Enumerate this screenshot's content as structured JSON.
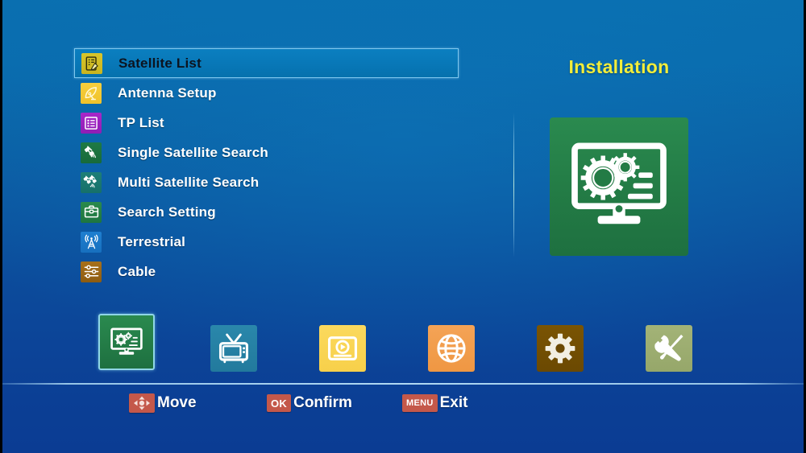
{
  "screen": {
    "title": "Installation",
    "accent_yellow": "#f2ed3a",
    "background_top": "#0a6fb0",
    "background_bottom": "#0b3c93",
    "highlight_border": "#7fc8ef"
  },
  "menu": {
    "selected_index": 0,
    "items": [
      {
        "label": "Satellite List",
        "icon": "satellite-list-icon",
        "tile_color": "#c9b520",
        "selected": true
      },
      {
        "label": "Antenna Setup",
        "icon": "antenna-dish-icon",
        "tile_color": "#f0c22b",
        "selected": false
      },
      {
        "label": "TP List",
        "icon": "transponder-list-icon",
        "tile_color": "#8f1eb4",
        "selected": false
      },
      {
        "label": "Single Satellite Search",
        "icon": "single-satellite-icon",
        "tile_color": "#176a3a",
        "selected": false
      },
      {
        "label": "Multi Satellite Search",
        "icon": "multi-satellite-icon",
        "tile_color": "#16706a",
        "selected": false
      },
      {
        "label": "Search Setting",
        "icon": "toolbox-icon",
        "tile_color": "#1e7540",
        "selected": false
      },
      {
        "label": "Terrestrial",
        "icon": "antenna-tower-icon",
        "tile_color": "#1770bf",
        "selected": false
      },
      {
        "label": "Cable",
        "icon": "sliders-icon",
        "tile_color": "#8d5c11",
        "selected": false
      }
    ]
  },
  "panel": {
    "title": "Installation",
    "icon": "monitor-gears-icon",
    "tile_color": "#237b45"
  },
  "iconbar": {
    "items": [
      {
        "name": "installation",
        "icon": "monitor-gears-icon",
        "tile_color": "#237b45",
        "selected": true
      },
      {
        "name": "channel",
        "icon": "tv-icon",
        "tile_color": "#227a9d",
        "selected": false
      },
      {
        "name": "media",
        "icon": "media-player-icon",
        "tile_color": "#f7d04a",
        "selected": false
      },
      {
        "name": "network",
        "icon": "globe-icon",
        "tile_color": "#ef9743",
        "selected": false
      },
      {
        "name": "system",
        "icon": "gear-icon",
        "tile_color": "#6b4902",
        "selected": false
      },
      {
        "name": "tools",
        "icon": "wrench-screwdriver-icon",
        "tile_color": "#96a76a",
        "selected": false
      }
    ]
  },
  "hints": {
    "badge_color": "#c4584a",
    "items": [
      {
        "key": "",
        "key_icon": "dpad-icon",
        "label": "Move"
      },
      {
        "key": "OK",
        "key_icon": "",
        "label": "Confirm"
      },
      {
        "key": "MENU",
        "key_icon": "",
        "label": "Exit"
      }
    ]
  }
}
